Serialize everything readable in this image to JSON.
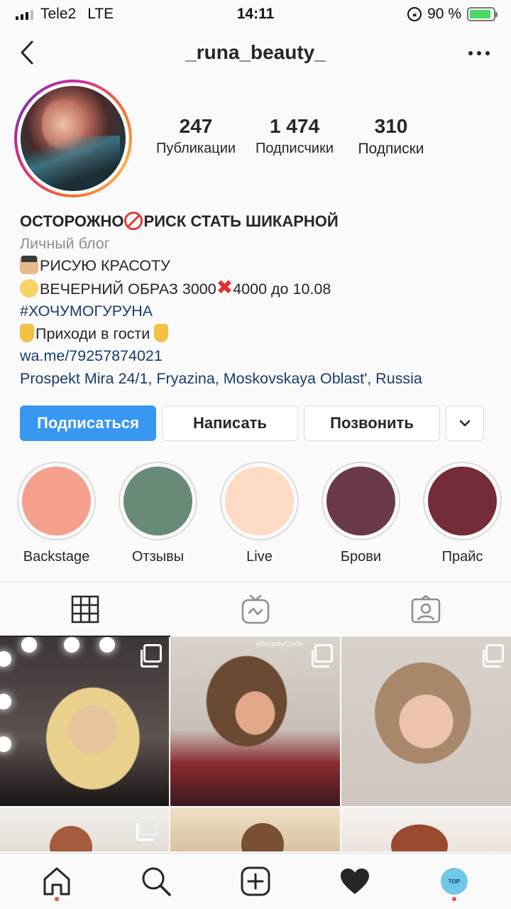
{
  "status_bar": {
    "carrier": "Tele2",
    "network": "LTE",
    "time": "14:11",
    "battery": "90 %",
    "battery_level": 0.9
  },
  "header": {
    "username": "_runa_beauty_"
  },
  "stats": [
    {
      "value": "247",
      "label": "Публикации"
    },
    {
      "value": "1 474",
      "label": "Подписчики"
    },
    {
      "value": "310",
      "label": "Подписки"
    }
  ],
  "bio": {
    "name_part1": "ОСТОРОЖНО",
    "name_part2": "РИСК СТАТЬ ШИКАРНОЙ",
    "category": "Личный блог",
    "line1": "РИСУЮ КРАСОТУ",
    "line2_part1": "ВЕЧЕРНИЙ ОБРАЗ 3000",
    "line2_part2": "4000 до 10.08",
    "hashtag": "#ХОЧУМОГУРУНА",
    "line4": "Приходи в гости ",
    "link": "wa.me/79257874021",
    "address": "Prospekt Mira 24/1, Fryazina, Moskovskaya Oblast', Russia"
  },
  "actions": {
    "follow": "Подписаться",
    "message": "Написать",
    "call": "Позвонить"
  },
  "highlights": [
    {
      "label": "Backstage",
      "color": "#f4a08c"
    },
    {
      "label": "Отзывы",
      "color": "#6a8a78"
    },
    {
      "label": "Live",
      "color": "#fedbc4"
    },
    {
      "label": "Брови",
      "color": "#6b3a4a"
    },
    {
      "label": "Прайс",
      "color": "#732c38"
    }
  ],
  "colors": {
    "accent": "#3897f0",
    "link": "#1a3c6e",
    "notification_dot": "#ed4956"
  },
  "icons": {
    "back": "chevron-left-icon",
    "more": "ellipsis-icon",
    "grid": "grid-icon",
    "igtv": "igtv-icon",
    "tagged": "tagged-icon",
    "home": "home-icon",
    "search": "search-icon",
    "add": "add-post-icon",
    "activity": "heart-icon",
    "profile": "profile-avatar"
  },
  "photo_watermark": "#BeautyCode",
  "profile_badge": "TOP"
}
